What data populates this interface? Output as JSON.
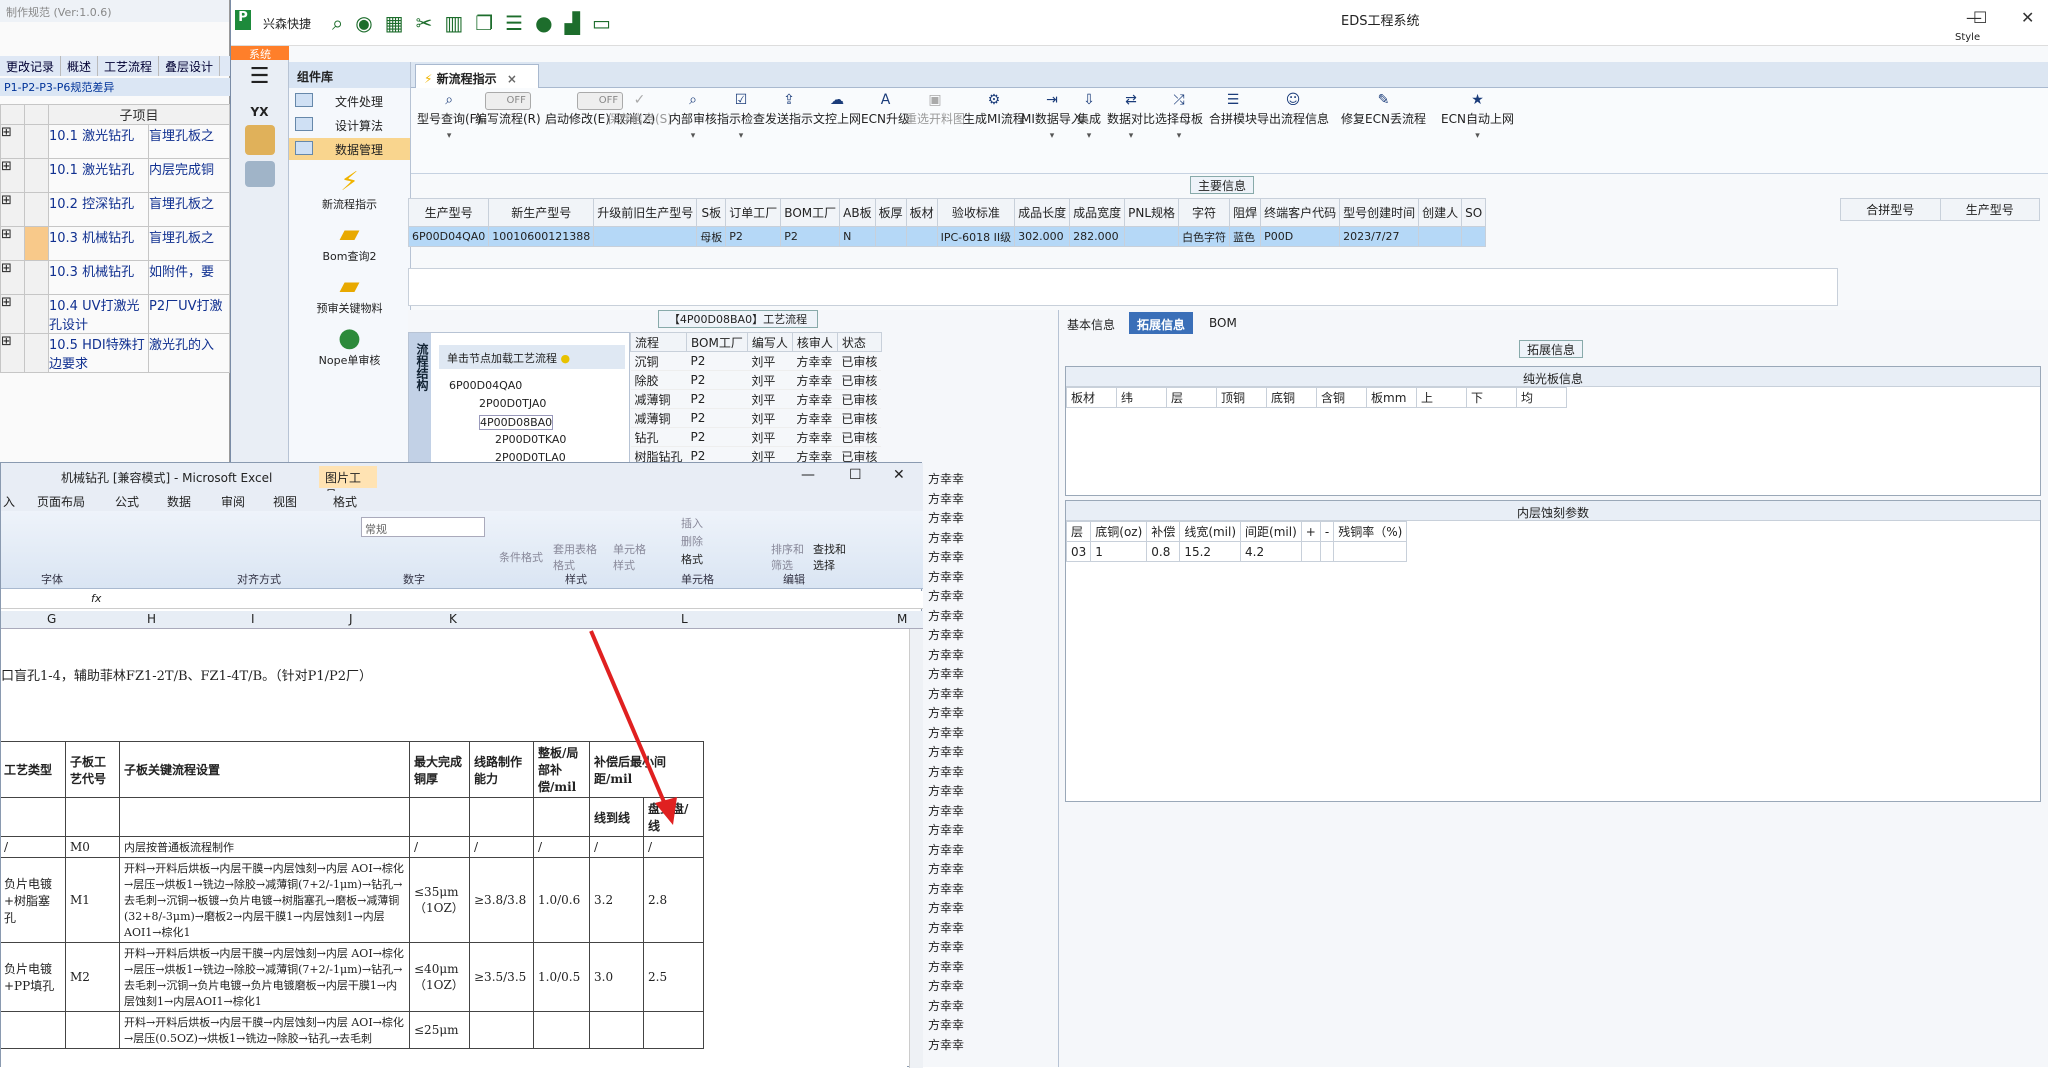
{
  "back_window": {
    "title": "制作规范 (Ver:1.0.6)",
    "menu": [
      "更改记录",
      "概述",
      "工艺流程",
      "叠层设计"
    ],
    "path": "P1-P2-P3-P6规范差异",
    "grid_header": "子项目",
    "rows": [
      {
        "name": "10.1 激光钻孔",
        "desc": "盲埋孔板之"
      },
      {
        "name": "10.1 激光钻孔",
        "desc": "内层完成铜"
      },
      {
        "name": "10.2 控深钻孔",
        "desc": "盲埋孔板之"
      },
      {
        "name": "10.3 机械钻孔",
        "desc": "盲埋孔板之"
      },
      {
        "name": "10.3 机械钻孔",
        "desc": "如附件，要"
      },
      {
        "name": "10.4 UV打激光孔设计",
        "desc": "P2厂UV打激"
      },
      {
        "name": "10.5 HDI特殊打边要求",
        "desc": "激光孔的入"
      }
    ]
  },
  "eds": {
    "app_name": "兴森快捷",
    "title": "EDS工程系统",
    "style_label": "Style",
    "sys_tab": "系统",
    "nav_label": "YX",
    "component_title": "组件库",
    "components": [
      "文件处理",
      "设计算法",
      "数据管理"
    ],
    "big_items": [
      "新流程指示",
      "Bom查询2",
      "预审关键物料",
      "Nope单审核"
    ],
    "tab": "新流程指示",
    "ribbon": [
      "型号查询(F)",
      "编写流程(R)",
      "启动修改(E) 取消(Z)",
      "保存信息(S)",
      "内部审核",
      "指示检查",
      "发送指示",
      "文控上网",
      "ECN升级",
      "重选开料图",
      "生成MI流程",
      "MI数据导入",
      "集成",
      "数据对比",
      "选择母板",
      "合拼模块",
      "导出流程信息",
      "修复ECN丢流程",
      "ECN自动上网"
    ],
    "toggle_text": "OFF",
    "main_info_caption": "主要信息",
    "main_headers": [
      "生产型号",
      "新生产型号",
      "升级前旧生产型号",
      "S板",
      "订单工厂",
      "BOM工厂",
      "AB板",
      "板厚",
      "板材",
      "验收标准",
      "成品长度",
      "成品宽度",
      "PNL规格",
      "字符",
      "阻焊",
      "终端客户代码",
      "型号创建时间",
      "创建人",
      "SO"
    ],
    "main_row": [
      "6P00D04QA0",
      "10010600121388",
      "",
      "母板",
      "P2",
      "P2",
      "N",
      "",
      "",
      "IPC-6018 II级",
      "302.000",
      "282.000",
      "",
      "白色字符",
      "蓝色",
      "P00D",
      "2023/7/27",
      "",
      ""
    ],
    "right_headers": [
      "合拼型号",
      "生产型号"
    ],
    "flow_caption": "【4P00D08BA0】工艺流程",
    "tree_side": "流程结构",
    "tree_head": "单击节点加载工艺流程",
    "tree_nodes": [
      "6P00D04QA0",
      "2P00D0TJA0",
      "4P00D08BA0",
      "2P00D0TKA0",
      "2P00D0TLA0"
    ],
    "flow_headers": [
      "流程",
      "BOM工厂",
      "编写人",
      "核审人",
      "状态"
    ],
    "flow_rows": [
      [
        "沉铜",
        "P2",
        "刘平",
        "方幸幸",
        "已审核"
      ],
      [
        "除胶",
        "P2",
        "刘平",
        "方幸幸",
        "已审核"
      ],
      [
        "减薄铜",
        "P2",
        "刘平",
        "方幸幸",
        "已审核"
      ],
      [
        "减薄铜",
        "P2",
        "刘平",
        "方幸幸",
        "已审核"
      ],
      [
        "钻孔",
        "P2",
        "刘平",
        "方幸幸",
        "已审核"
      ],
      [
        "树脂钻孔",
        "P2",
        "刘平",
        "方幸幸",
        "已审核"
      ]
    ],
    "extra_reviewer": "方幸幸",
    "extra_status": "已审核",
    "info_tabs": [
      "基本信息",
      "拓展信息",
      "BOM"
    ],
    "ext_caption": "拓展信息",
    "core_box_title": "纯光板信息",
    "core_headers": [
      "板材",
      "纬",
      "层",
      "顶铜",
      "底铜",
      "含铜",
      "板mm",
      "上",
      "下",
      "均"
    ],
    "etch_box_title": "内层蚀刻参数",
    "etch_headers": [
      "层",
      "底铜(oz)",
      "补偿",
      "线宽(mil)",
      "间距(mil)",
      "+",
      "-",
      "残铜率（%)"
    ],
    "etch_row": [
      "03",
      "1",
      "0.8",
      "15.2",
      "4.2",
      "",
      "",
      ""
    ]
  },
  "excel": {
    "title": "机械钻孔 [兼容模式] - Microsoft Excel",
    "pic_tools": "图片工具",
    "tabs": [
      "入",
      "页面布局",
      "公式",
      "数据",
      "审阅",
      "视图",
      "格式"
    ],
    "groups": [
      "字体",
      "对齐方式",
      "数字",
      "样式",
      "单元格",
      "编辑"
    ],
    "number_format": "常规",
    "ribbon_btns": [
      "条件格式",
      "套用表格格式",
      "单元格样式",
      "插入",
      "删除",
      "格式",
      "排序和筛选",
      "查找和选择"
    ],
    "cols": [
      "G",
      "H",
      "I",
      "J",
      "K",
      "L",
      "M"
    ],
    "note": "口盲孔1-4，辅助菲林FZ1-2T/B、FZ1-4T/B。（针对P1/P2厂）",
    "sheet_headers": [
      "工艺类型",
      "子板工艺代号",
      "子板关键流程设置",
      "最大完成铜厚",
      "线路制作能力",
      "整板/局部补偿/mil",
      "补偿后最小间距/mil"
    ],
    "sub_headers": [
      "线到线",
      "盘到盘/线"
    ],
    "sheet_rows": [
      [
        "/",
        "M0",
        "内层按普通板流程制作",
        "/",
        "/",
        "/",
        "/",
        "/"
      ],
      [
        "负片电镀+树脂塞孔",
        "M1",
        "开料→开料后烘板→内层干膜→内层蚀刻→内层 AOI→棕化→层压→烘板1→铣边→除胶→减薄铜(7+2/-1μm)→钻孔→去毛刺→沉铜→板镀→负片电镀→树脂塞孔→磨板→减薄铜(32+8/-3μm)→磨板2→内层干膜1→内层蚀刻1→内层AOI1→棕化1",
        "≤35μm（1OZ）",
        "≥3.8/3.8",
        "1.0/0.6",
        "3.2",
        "2.8"
      ],
      [
        "负片电镀+PP填孔",
        "M2",
        "开料→开料后烘板→内层干膜→内层蚀刻→内层 AOI→棕化→层压→烘板1→铣边→除胶→减薄铜(7+2/-1μm)→钻孔→去毛刺→沉铜→负片电镀→负片电镀磨板→内层干膜1→内层蚀刻1→内层AOI1→棕化1",
        "≤40μm（1OZ）",
        "≥3.5/3.5",
        "1.0/0.5",
        "3.0",
        "2.5"
      ],
      [
        "",
        "",
        "开料→开料后烘板→内层干膜→内层蚀刻→内层 AOI→棕化→层压(0.5OZ)→烘板1→铣边→除胶→钻孔→去毛刺",
        "≤25μm",
        "",
        "",
        "",
        ""
      ]
    ]
  }
}
